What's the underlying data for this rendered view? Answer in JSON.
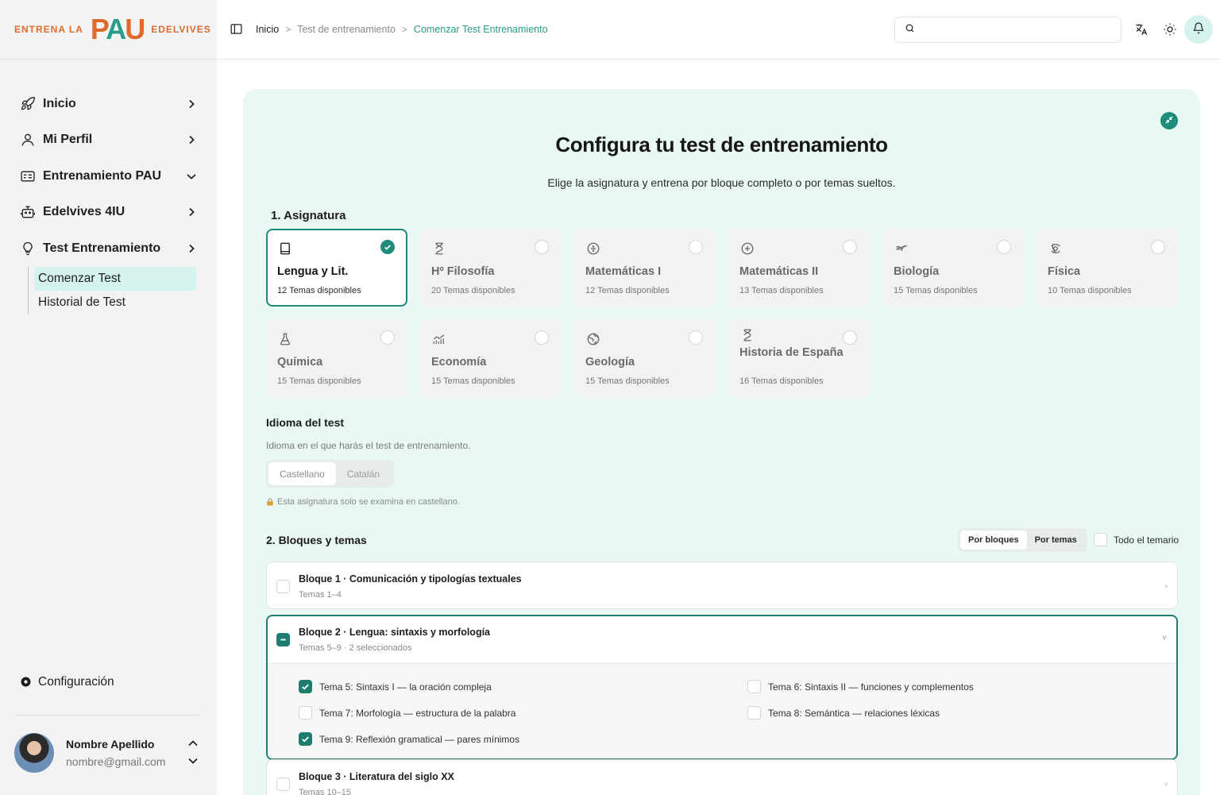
{
  "brand": {
    "left": "ENTRENA LA",
    "pau_p": "P",
    "pau_a": "A",
    "pau_u": "U",
    "right": "EDELVIVES",
    "colors": {
      "orange": "#e06a2c",
      "teal": "#2a9c8b"
    }
  },
  "sidebar": {
    "items": [
      {
        "label": "Inicio",
        "icon": "rocket-icon",
        "chevron": "right"
      },
      {
        "label": "Mi Perfil",
        "icon": "user-icon",
        "chevron": "right"
      },
      {
        "label": "Entrenamiento PAU",
        "icon": "id-card-icon",
        "chevron": "down"
      },
      {
        "label": "Edelvives 4IU",
        "icon": "robot-icon",
        "chevron": "right"
      },
      {
        "label": "Test Entrenamiento",
        "icon": "lightbulb-icon",
        "chevron": "right"
      }
    ],
    "subitems": [
      {
        "label": "Comenzar Test",
        "active": true
      },
      {
        "label": "Historial de Test",
        "active": false
      }
    ],
    "config_label": "Configuración",
    "user": {
      "name": "Nombre Apellido",
      "email": "nombre@gmail.com"
    }
  },
  "header": {
    "breadcrumb": [
      "Inicio",
      "Test de entrenamiento",
      "Comenzar Test Entrenamiento"
    ],
    "search": {
      "value": "",
      "placeholder": ""
    }
  },
  "main": {
    "title": "Configura tu test de entrenamiento",
    "subtitle": "Elige la asignatura y entrena por bloque completo o por temas sueltos.",
    "section1": "1. Asignatura",
    "subjects": [
      {
        "name": "Lengua y Lit.",
        "count": "12 Temas disponibles",
        "icon": "book-icon",
        "selected": true
      },
      {
        "name": "Hº Filosofía",
        "count": "20 Temas disponibles",
        "icon": "hourglass-icon",
        "selected": false
      },
      {
        "name": "Matemáticas I",
        "count": "12 Temas disponibles",
        "icon": "divide-icon",
        "selected": false
      },
      {
        "name": "Matemáticas II",
        "count": "13 Temas disponibles",
        "icon": "plus-circle-icon",
        "selected": false
      },
      {
        "name": "Biología",
        "count": "15 Temas disponibles",
        "icon": "dna-icon",
        "selected": false
      },
      {
        "name": "Física",
        "count": "10 Temas disponibles",
        "icon": "orbit-icon",
        "selected": false
      },
      {
        "name": "Química",
        "count": "15 Temas disponibles",
        "icon": "flask-icon",
        "selected": false
      },
      {
        "name": "Economía",
        "count": "15 Temas disponibles",
        "icon": "chart-icon",
        "selected": false
      },
      {
        "name": "Geología",
        "count": "15 Temas disponibles",
        "icon": "globe-icon",
        "selected": false
      },
      {
        "name": "Historia de España",
        "count": "16 Temas disponibles",
        "icon": "hourglass-icon",
        "selected": false
      }
    ],
    "language": {
      "title": "Idioma del test",
      "description": "Idioma en el que harás el test de entrenamiento.",
      "options": [
        "Castellano",
        "Catalán"
      ],
      "note": "Esta asignatura solo se examina en castellano."
    },
    "section2": "2. Bloques y temas",
    "modes": [
      "Por bloques",
      "Por temas"
    ],
    "todo_label": "Todo el temario",
    "bloques": [
      {
        "title": "Bloque 1 · Comunicación y tipologías textuales",
        "sub": "Temas 1–4",
        "state": "none",
        "open": false,
        "chevron": "›"
      },
      {
        "title": "Bloque 2 · Lengua: sintaxis y morfología",
        "sub": "Temas 5–9 · 2 seleccionados",
        "state": "partial",
        "open": true,
        "chevron": "˅",
        "temas": [
          {
            "label": "Tema 5: Sintaxis I — la oración compleja",
            "checked": true
          },
          {
            "label": "Tema 6: Sintaxis II — funciones y complementos",
            "checked": false
          },
          {
            "label": "Tema 7: Morfología — estructura de la palabra",
            "checked": false
          },
          {
            "label": "Tema 8: Semántica — relaciones léxicas",
            "checked": false
          },
          {
            "label": "Tema 9: Reflexión gramatical — pares mínimos",
            "checked": true
          }
        ]
      },
      {
        "title": "Bloque 3 · Literatura del siglo XX",
        "sub": "Temas 10–15",
        "state": "none",
        "open": false,
        "chevron": "›"
      }
    ]
  }
}
